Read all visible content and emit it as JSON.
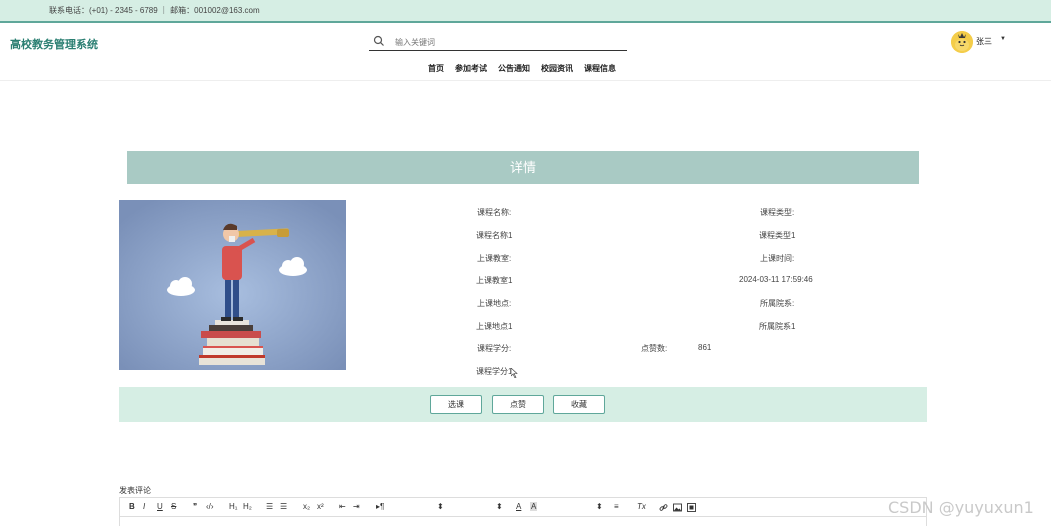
{
  "topbar": {
    "contact": "联系电话：(+01) - 2345 - 6789 ｜ 邮箱：001002@163.com"
  },
  "header": {
    "brand": "高校教务管理系统",
    "search_placeholder": "输入关键词",
    "nav": [
      "首页",
      "参加考试",
      "公告通知",
      "校园资讯",
      "课程信息"
    ],
    "user": {
      "name": "张三"
    }
  },
  "detail": {
    "title": "详情",
    "fields": {
      "course_name_label": "课程名称:",
      "course_name_value": "课程名称1",
      "course_type_label": "课程类型:",
      "course_type_value": "课程类型1",
      "classroom_label": "上课教室:",
      "classroom_value": "上课教室1",
      "class_time_label": "上课时间:",
      "class_time_value": "2024-03-11 17:59:46",
      "location_label": "上课地点:",
      "location_value": "上课地点1",
      "department_label": "所属院系:",
      "department_value": "所属院系1",
      "credit_label": "课程学分:",
      "credit_value": "课程学分1",
      "likes_label": "点赞数:",
      "likes_value": "861"
    }
  },
  "actions": {
    "select": "选课",
    "like": "点赞",
    "favorite": "收藏"
  },
  "comment": {
    "label": "发表评论",
    "toolbar": {
      "bold": "B",
      "italic": "I",
      "underline": "U",
      "strike": "S",
      "quote": "❞",
      "code": "‹/›",
      "h1": "H₁",
      "h2": "H₂",
      "ordered": "☰",
      "bullet": "☰",
      "sub": "x₂",
      "sup": "x²",
      "outdent": "⇤",
      "indent": "⇥",
      "direction": "▸¶",
      "size_arrow": "⬍",
      "header_arrow": "⬍",
      "font_arrow": "⬍",
      "color": "A",
      "background": "A",
      "align": "≡",
      "clean": "Tx"
    }
  },
  "watermark": "CSDN @yuyuxun1"
}
